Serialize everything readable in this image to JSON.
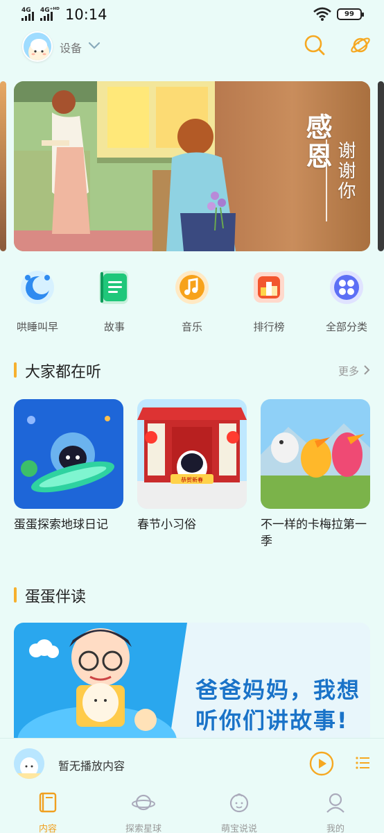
{
  "status": {
    "sim1": "4G",
    "sim2": "4G⁺ᴴᴰ",
    "time": "10:14",
    "battery": "99"
  },
  "header": {
    "device_label": "设备"
  },
  "banner": {
    "title": "感恩",
    "subtitle": "谢谢你"
  },
  "categories": [
    {
      "label": "哄睡叫早",
      "icon": "moon-clock-icon"
    },
    {
      "label": "故事",
      "icon": "book-icon"
    },
    {
      "label": "音乐",
      "icon": "music-note-icon"
    },
    {
      "label": "排行榜",
      "icon": "podium-icon"
    },
    {
      "label": "全部分类",
      "icon": "grid-icon"
    }
  ],
  "popular": {
    "title": "大家都在听",
    "more": "更多",
    "cards": [
      {
        "title": "蛋蛋探索地球日记"
      },
      {
        "title": "春节小习俗",
        "badge": "恭贺新春"
      },
      {
        "title": "不一样的卡梅拉第一季"
      }
    ]
  },
  "reading": {
    "title": "蛋蛋伴读",
    "line1": "爸爸妈妈，我想",
    "line2": "听你们讲故事!"
  },
  "player": {
    "text": "暂无播放内容"
  },
  "tabs": [
    {
      "label": "内容",
      "active": true
    },
    {
      "label": "探索星球",
      "active": false
    },
    {
      "label": "萌宝说说",
      "active": false
    },
    {
      "label": "我的",
      "active": false
    }
  ],
  "colors": {
    "background": "#eafbf8",
    "accent": "#f6b02e",
    "active_tab": "#f0a020"
  }
}
